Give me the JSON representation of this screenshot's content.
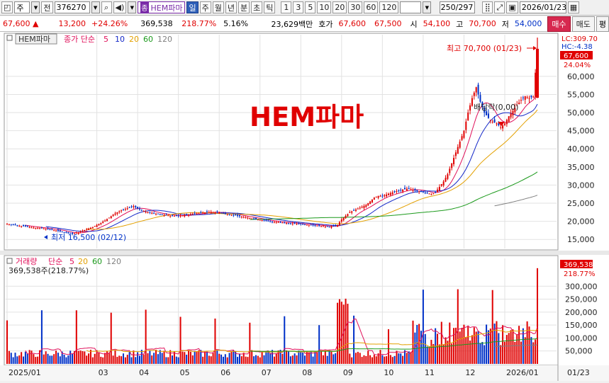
{
  "toolbar": {
    "market": "주",
    "prev_label": "전",
    "code": "376270",
    "name_badge": "종",
    "name": "HEM파마",
    "periods": [
      "일",
      "주",
      "월",
      "년",
      "분",
      "초",
      "틱"
    ],
    "counts": [
      "1",
      "3",
      "5",
      "10",
      "20",
      "30",
      "60",
      "120"
    ],
    "range": "250/297",
    "date": "2026/01/23",
    "icons": [
      "chart-type-icon",
      "search-icon",
      "sound-icon"
    ]
  },
  "quote": {
    "price": "67,600",
    "change": "13,200",
    "change_pct": "+24.26%",
    "volume": "369,538",
    "volume_ratio": "218.77%",
    "turnover": "5.16%",
    "trade_value": "23,629백만",
    "ask_label": "호가",
    "ask1": "67,600",
    "ask2": "67,500",
    "open_label": "시",
    "open": "54,100",
    "high_label": "고",
    "high": "70,700",
    "low_label": "저",
    "low": "54,000",
    "buy_label": "매수",
    "sell_label": "매도",
    "extra_label": "평"
  },
  "price_panel": {
    "name_box": "HEM파마",
    "legend_label": "종가 단순",
    "ma_periods": [
      "5",
      "10",
      "20",
      "60",
      "120"
    ],
    "ma_colors": [
      "#e0105a",
      "#1428c8",
      "#e3a000",
      "#1c9a1c",
      "#808080"
    ],
    "watermark": "HEM파마",
    "lc": "LC:309.70",
    "hc": "HC:-4.38",
    "last_price_tag": "67,600",
    "last_pct_tag": "24.04%",
    "high_annot": "최고 70,700 (01/23)",
    "low_annot": "최저 16,500 (02/12)",
    "dividend_annot": "배당락(0,00)"
  },
  "volume_panel": {
    "legend_label": "거래량",
    "legend_ma_label": "단순",
    "ma_periods": [
      "5",
      "20",
      "60",
      "120"
    ],
    "ma_colors": [
      "#e0105a",
      "#e3a000",
      "#1c9a1c",
      "#808080"
    ],
    "value_line": "369,538주(218.77%)",
    "last_tag": "369,538",
    "last_pct_tag": "218.77%"
  },
  "x_axis": {
    "labels": [
      "2025/01",
      "03",
      "04",
      "05",
      "06",
      "07",
      "08",
      "09",
      "10",
      "11",
      "12",
      "2026/01"
    ],
    "right_label": "01/23"
  },
  "colors": {
    "up": "#e00000",
    "down": "#0031c8",
    "grid": "#e2e2e2"
  },
  "chart_data": [
    {
      "type": "candlestick",
      "title": "",
      "y_axis_labels": [
        "15,000",
        "20,000",
        "25,000",
        "30,000",
        "35,000",
        "40,000",
        "45,000",
        "50,000",
        "55,000",
        "60,000"
      ],
      "ylim": [
        12500,
        71500
      ],
      "grid": true,
      "x": [
        "2025/01",
        "03",
        "04",
        "05",
        "06",
        "07",
        "08",
        "09",
        "10",
        "11",
        "12",
        "2026/01"
      ],
      "close_series": [
        {
          "month": "2025/01",
          "values": [
            19300,
            19100,
            18900,
            18800,
            18700,
            18500,
            18300,
            18200,
            18100,
            18000,
            17800,
            17700
          ]
        },
        {
          "month": "2025/02",
          "values": [
            17500,
            17200,
            16900,
            16700,
            16500,
            16800,
            17200,
            17600,
            18000,
            18400
          ]
        },
        {
          "month": "2025/03",
          "values": [
            19000,
            19600,
            20200,
            21000,
            21800,
            22500,
            23000,
            23400,
            23800,
            24200
          ]
        },
        {
          "month": "2025/04",
          "values": [
            23500,
            23000,
            22600,
            22400,
            22200,
            22000,
            21800,
            21700,
            21600,
            21500
          ]
        },
        {
          "month": "2025/05",
          "values": [
            21500,
            21600,
            21800,
            22000,
            22200,
            22300,
            22400,
            22500,
            22600,
            22500
          ]
        },
        {
          "month": "2025/06",
          "values": [
            22400,
            22200,
            22000,
            21800,
            21600,
            21400,
            21200,
            21000,
            20800,
            20600
          ]
        },
        {
          "month": "2025/07",
          "values": [
            20400,
            20200,
            20000,
            19900,
            19800,
            19700,
            19600,
            19500,
            19400,
            19300
          ]
        },
        {
          "month": "2025/08",
          "values": [
            19200,
            19100,
            19000,
            18900,
            18800,
            18700,
            18600,
            18500,
            18700,
            19000
          ]
        },
        {
          "month": "2025/09",
          "values": [
            20500,
            21500,
            22500,
            23000,
            23500,
            24000,
            24500,
            25500,
            26500,
            27000
          ]
        },
        {
          "month": "2025/10",
          "values": [
            27000,
            27400,
            27800,
            28200,
            28500,
            28800,
            29000,
            28800,
            28500,
            28300
          ]
        },
        {
          "month": "2025/11",
          "values": [
            28000,
            27800,
            27500,
            28000,
            29500,
            31000,
            33000,
            36000,
            39000,
            42000
          ]
        },
        {
          "month": "2025/12",
          "values": [
            45000,
            50000,
            54000,
            57000,
            53000,
            50000,
            48500,
            47500,
            47000,
            46000
          ]
        },
        {
          "month": "2026/01",
          "values": [
            47000,
            49000,
            50500,
            52000,
            53500,
            54500,
            54000,
            54400,
            67600
          ]
        }
      ],
      "period_high": 70700,
      "period_low": 16500
    },
    {
      "type": "bar",
      "title": "",
      "y_axis_labels": [
        "50,000",
        "100,000",
        "150,000",
        "200,000",
        "250,000",
        "300,000"
      ],
      "ylim": [
        0,
        380000
      ],
      "grid": true,
      "last_value": 369538
    }
  ]
}
